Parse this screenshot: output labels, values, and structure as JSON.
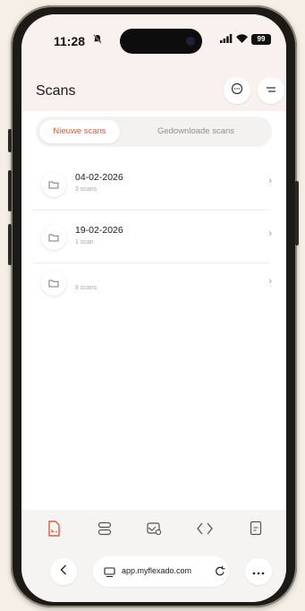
{
  "status_bar": {
    "time": "11:28",
    "battery": "99",
    "notification_icon": "bell-off-icon",
    "signal_icon": "signal-icon",
    "wifi_icon": "wifi-icon"
  },
  "header": {
    "title": "Scans",
    "chat_icon": "chat-bubble-icon",
    "menu_icon": "menu-lines-icon"
  },
  "tabs": [
    {
      "label": "Nieuwe scans",
      "active": true
    },
    {
      "label": "Gedownloade scans",
      "active": false
    }
  ],
  "scan_groups": [
    {
      "date": "04-02-2026",
      "count": "3 scans"
    },
    {
      "date": "19-02-2026",
      "count": "1 scan"
    },
    {
      "date": "",
      "count": "8 scans"
    }
  ],
  "bottom_nav": {
    "items": [
      {
        "icon": "scan-document-icon",
        "active": true
      },
      {
        "icon": "layout-icon",
        "active": false
      },
      {
        "icon": "image-settings-icon",
        "active": false
      },
      {
        "icon": "diamond-code-icon",
        "active": false
      },
      {
        "icon": "document-icon",
        "active": false
      }
    ]
  },
  "browser": {
    "url": "app.myflexado.com",
    "back_icon": "chevron-left-icon",
    "site_icon": "site-settings-icon",
    "reload_icon": "reload-icon",
    "more_icon": "more-dots-icon"
  },
  "colors": {
    "accent": "#e0593a",
    "background": "#f6efe7",
    "header_bg": "#f8f1ee"
  }
}
